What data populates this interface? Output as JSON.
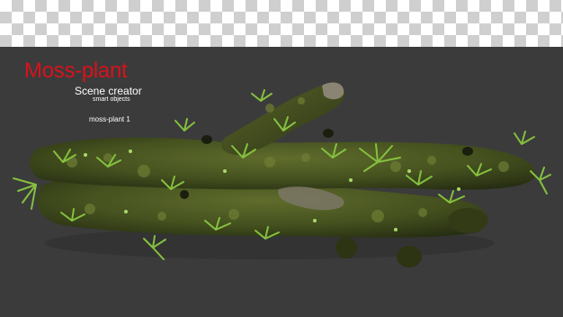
{
  "header": {
    "title": "Moss-plant",
    "subtitle": "Scene creator",
    "subtitle_small": "smart objects"
  },
  "caption": "moss-plant 1",
  "colors": {
    "title": "#d8121c",
    "background": "#3b3b3b",
    "moss_dark": "#2f3a18",
    "moss_mid": "#4e5d23",
    "leaf": "#7fbf3a"
  }
}
